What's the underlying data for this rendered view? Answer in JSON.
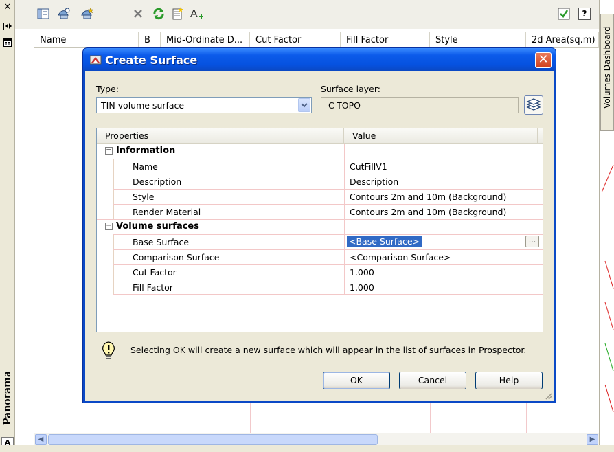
{
  "left_strip": {
    "close_glyph": "✕",
    "panorama_label": "Panorama",
    "bottom_badge": "A"
  },
  "toolbar": {
    "icons": [
      "panel-icon",
      "add-surface-icon",
      "new-surface-icon",
      "delete-icon",
      "refresh-icon",
      "report-icon",
      "add-text-icon",
      "checkbox-icon",
      "help-icon"
    ],
    "help_glyph": "?"
  },
  "grid": {
    "columns": [
      "Name",
      "B",
      "Mid-Ordinate D...",
      "Cut Factor",
      "Fill Factor",
      "Style",
      "2d Area(sq.m)"
    ]
  },
  "right_panel": {
    "tab_label": "Volumes Dashboard"
  },
  "dialog": {
    "title": "Create Surface",
    "close_glyph": "✕",
    "type_label": "Type:",
    "type_value": "TIN volume surface",
    "surface_layer_label": "Surface layer:",
    "surface_layer_value": "C-TOPO",
    "properties": {
      "col_property": "Properties",
      "col_value": "Value",
      "categories": [
        {
          "name": "Information",
          "rows": [
            {
              "property": "Name",
              "value": "CutFillV1"
            },
            {
              "property": "Description",
              "value": "Description"
            },
            {
              "property": "Style",
              "value": "Contours 2m and 10m (Background)"
            },
            {
              "property": "Render Material",
              "value": "Contours 2m and 10m (Background)"
            }
          ]
        },
        {
          "name": "Volume surfaces",
          "rows": [
            {
              "property": "Base Surface",
              "value": "<Base Surface>"
            },
            {
              "property": "Comparison Surface",
              "value": "<Comparison Surface>"
            },
            {
              "property": "Cut Factor",
              "value": "1.000"
            },
            {
              "property": "Fill Factor",
              "value": "1.000"
            }
          ]
        }
      ],
      "ellipsis": "..."
    },
    "info_message": "Selecting OK will create a new surface which will appear in the list of surfaces in Prospector.",
    "buttons": {
      "ok": "OK",
      "cancel": "Cancel",
      "help": "Help"
    }
  },
  "colors": {
    "title_blue": "#0c5bea",
    "dialog_face": "#ece9d8",
    "selection": "#316ac5",
    "close_red": "#d2401c"
  }
}
